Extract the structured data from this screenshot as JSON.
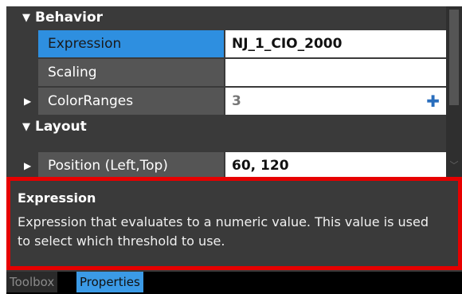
{
  "property_grid": {
    "sections": {
      "behavior": {
        "toggle": "▼",
        "label": "Behavior"
      },
      "layout": {
        "toggle": "▼",
        "label": "Layout"
      }
    },
    "rows": {
      "expression": {
        "name": "Expression",
        "value": "NJ_1_CIO_2000"
      },
      "scaling": {
        "name": "Scaling",
        "value": ""
      },
      "colorranges": {
        "expander": "▶",
        "name": "ColorRanges",
        "value": "3",
        "add": "✚"
      },
      "position": {
        "expander": "▶",
        "name": "Position (Left,Top)",
        "value": "60, 120"
      }
    }
  },
  "description": {
    "title": "Expression",
    "text": "Expression that evaluates to a numeric value. This value is used to select which threshold to use."
  },
  "tabs": {
    "toolbox": "Toolbox",
    "properties": "Properties"
  },
  "colors": {
    "selected": "#2e8fe0",
    "highlight_border": "#e60000",
    "active_tab": "#3b9ae6"
  }
}
